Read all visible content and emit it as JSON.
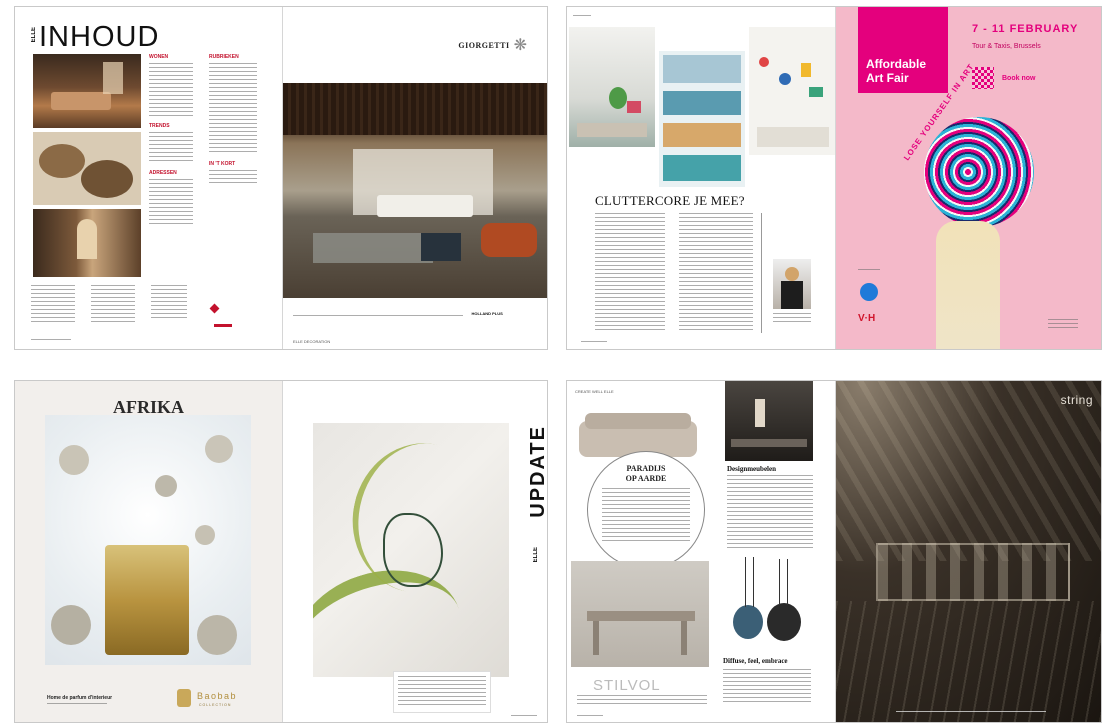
{
  "spread1": {
    "inhoud_title": "INHOUD",
    "elle_vertical": "ELLE",
    "sections": [
      "WONEN",
      "TRENDS",
      "ADRESSEN",
      "RUBRIEKEN",
      "IN 'T KORT"
    ],
    "sponsor_brand": "GIORGETTI",
    "caption_line": "HOLLAND PLUS",
    "footer": "ELLE DECORATION"
  },
  "spread2": {
    "headline": "CLUTTERCORE JE MEE?",
    "ad_logo_line1": "Affordable",
    "ad_logo_line2": "Art Fair",
    "ad_dates": "7 - 11 FEBRUARY",
    "ad_venue": "Tour & Taxis, Brussels",
    "ad_button": "Book now",
    "ad_slogan": "LOSE YOURSELF IN ART",
    "ad_partner": "V·H"
  },
  "spread3": {
    "ad_title": "AFRIKA",
    "ad_tagline": "Home de parfum d'interieur",
    "ad_brand": "Baobab",
    "ad_brand_sub": "COLLECTION",
    "update_title": "UPDATE",
    "update_brand": "ELLE"
  },
  "spread4": {
    "section_label": "CREATE WELL ELLE",
    "circle_headline_1": "PARADIJS",
    "circle_headline_2": "OP AARDE",
    "designmeubelen": "Designmeubelen",
    "stilvol": "STILVOL",
    "diffuse": "Diffuse, feel, embrace",
    "ad_brand": "string"
  }
}
